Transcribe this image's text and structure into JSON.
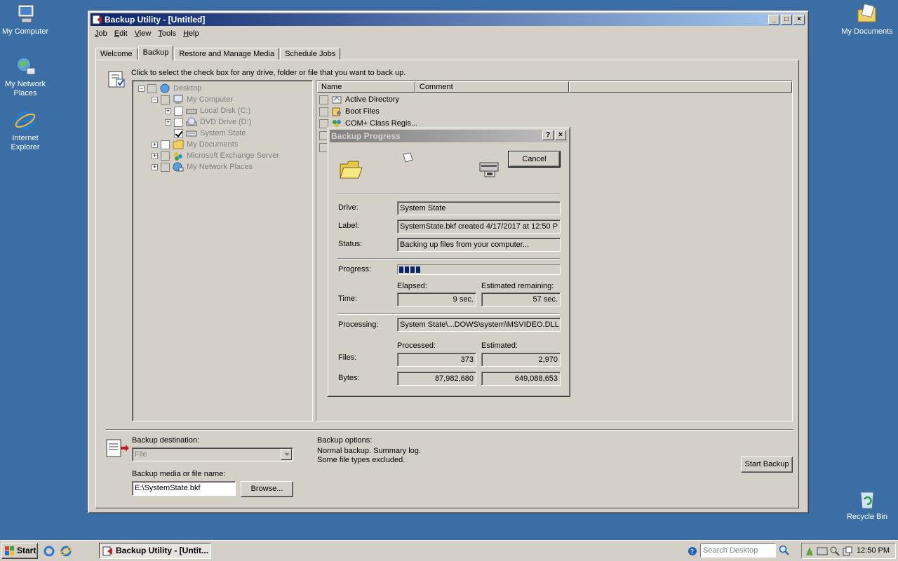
{
  "desktop": {
    "icons": [
      {
        "label": "My Computer"
      },
      {
        "label": "My Network Places"
      },
      {
        "label": "Internet Explorer"
      },
      {
        "label": "My Documents"
      },
      {
        "label": "Recycle Bin"
      }
    ]
  },
  "window": {
    "title": "Backup Utility - [Untitled]",
    "menu": [
      {
        "key": "J",
        "rest": "ob"
      },
      {
        "key": "E",
        "rest": "dit"
      },
      {
        "key": "V",
        "rest": "iew"
      },
      {
        "key": "T",
        "rest": "ools"
      },
      {
        "key": "H",
        "rest": "elp"
      }
    ],
    "tabs": [
      "Welcome",
      "Backup",
      "Restore and Manage Media",
      "Schedule Jobs"
    ],
    "active_tab": "Backup"
  },
  "backup": {
    "instruction": "Click to select the check box for any drive, folder or file that you want to back up.",
    "tree": [
      {
        "label": "Desktop",
        "checked": false
      },
      {
        "label": "My Computer",
        "checked": false
      },
      {
        "label": "Local Disk (C:)",
        "checked": false
      },
      {
        "label": "DVD Drive (D:)",
        "checked": false
      },
      {
        "label": "System State",
        "checked": true
      },
      {
        "label": "My Documents",
        "checked": false
      },
      {
        "label": "Microsoft Exchange Server",
        "checked": false
      },
      {
        "label": "My Network Places",
        "checked": false
      }
    ],
    "list_columns": [
      "Name",
      "Comment"
    ],
    "list_items": [
      "Active Directory",
      "Boot Files",
      "COM+ Class Regis..."
    ],
    "destination_label": "Backup destination:",
    "destination_value": "File",
    "media_label": "Backup media or file name:",
    "media_value": "E:\\SystemState.bkf",
    "browse_label": "Browse...",
    "options_title": "Backup options:",
    "options_line1": "Normal backup.  Summary log.",
    "options_line2": "Some file types excluded.",
    "start_label": "Start Backup"
  },
  "progress": {
    "title": "Backup Progress",
    "cancel_label": "Cancel",
    "drive_label": "Drive:",
    "drive_value": "System State",
    "label_label": "Label:",
    "label_value": "SystemState.bkf created 4/17/2017 at 12:50 P",
    "status_label": "Status:",
    "status_value": "Backing up files from your computer...",
    "progress_label": "Progress:",
    "progress_fraction": 0.13,
    "elapsed_label": "Elapsed:",
    "remaining_label": "Estimated remaining:",
    "time_label": "Time:",
    "elapsed_value": "9 sec.",
    "remaining_value": "57 sec.",
    "processing_label": "Processing:",
    "processing_value": "System State\\...DOWS\\system\\MSVIDEO.DLL",
    "processed_label": "Processed:",
    "estimated_label": "Estimated:",
    "files_label": "Files:",
    "files_processed": "373",
    "files_estimated": "2,970",
    "bytes_label": "Bytes:",
    "bytes_processed": "87,982,680",
    "bytes_estimated": "649,088,653"
  },
  "taskbar": {
    "start_label": "Start",
    "task_label": "Backup Utility - [Untit...",
    "search_placeholder": "Search Desktop",
    "clock": "12:50 PM"
  }
}
